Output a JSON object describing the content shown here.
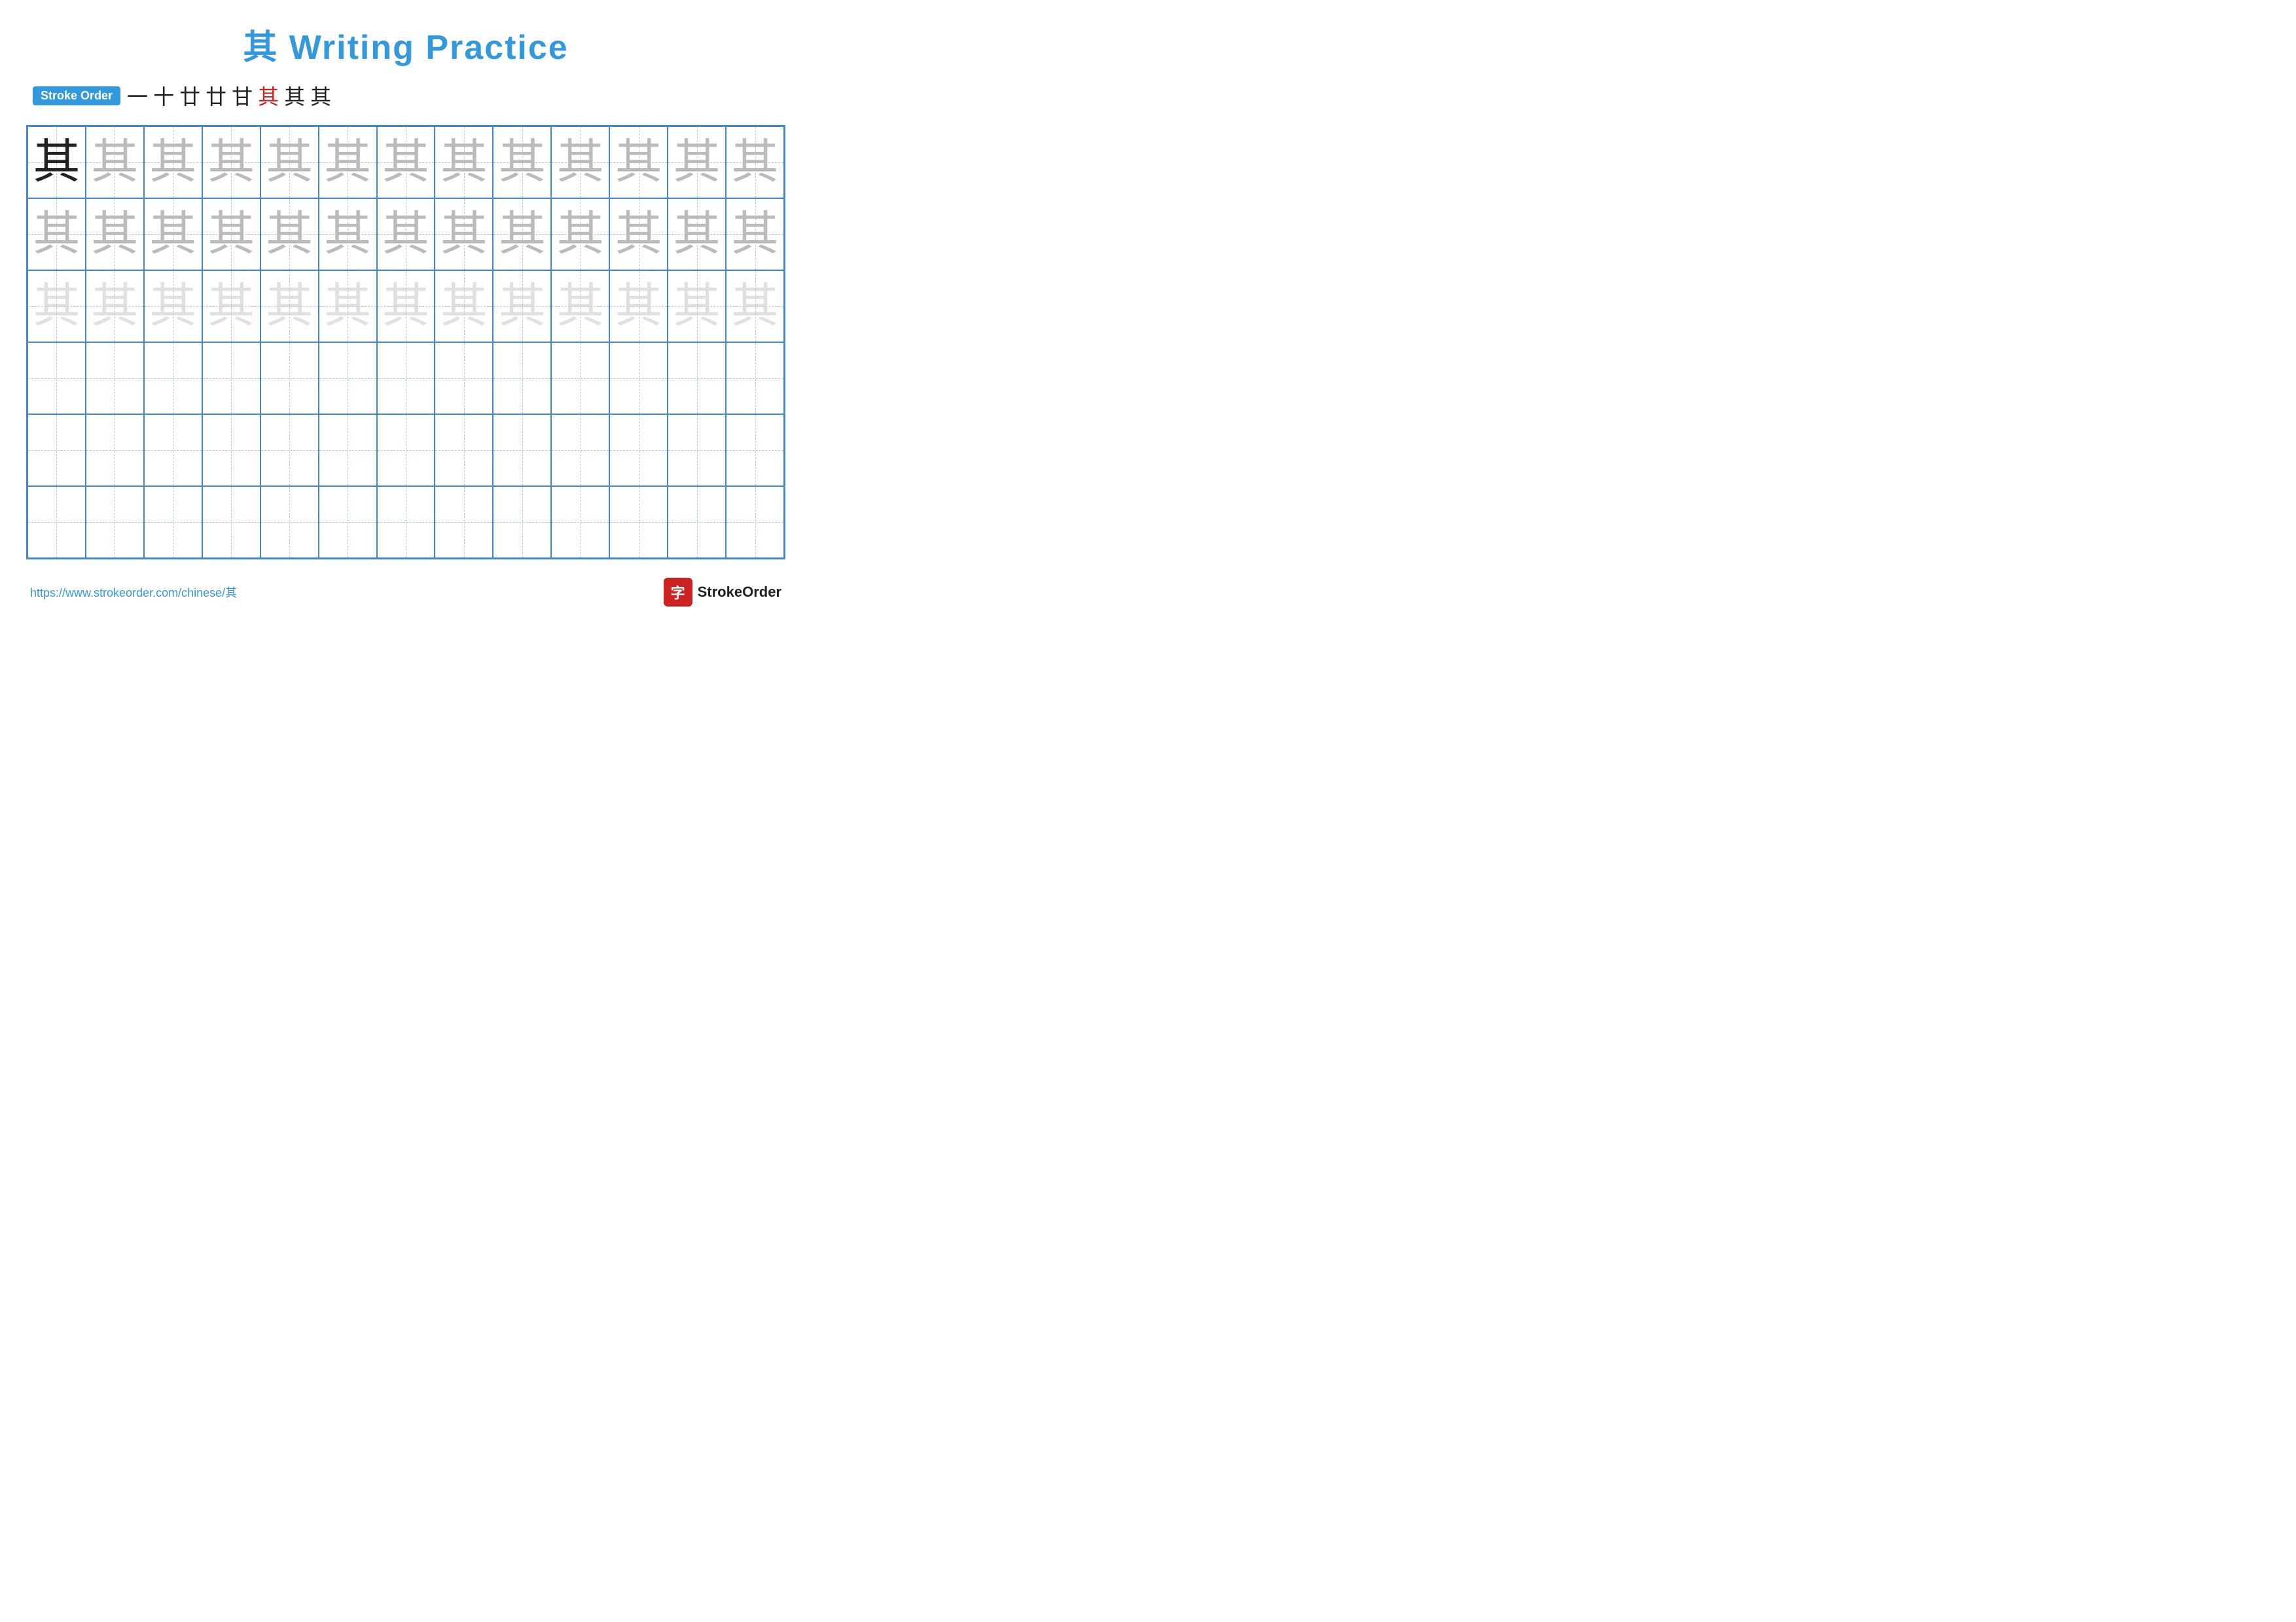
{
  "page": {
    "title": "其 Writing Practice",
    "stroke_order_label": "Stroke Order",
    "stroke_sequence": [
      "一",
      "十",
      "廿",
      "廿",
      "甘",
      "其",
      "其",
      "其"
    ],
    "stroke_highlight_index": 5,
    "character": "其",
    "url": "https://www.strokeorder.com/chinese/其",
    "logo_text": "StrokeOrder",
    "logo_char": "字",
    "grid": {
      "cols": 13,
      "rows": 6,
      "row_configs": [
        {
          "type": "dark_then_medium",
          "dark_count": 1,
          "medium_count": 12
        },
        {
          "type": "medium",
          "count": 13
        },
        {
          "type": "light",
          "count": 13
        },
        {
          "type": "empty",
          "count": 13
        },
        {
          "type": "empty",
          "count": 13
        },
        {
          "type": "empty",
          "count": 13
        }
      ]
    }
  }
}
